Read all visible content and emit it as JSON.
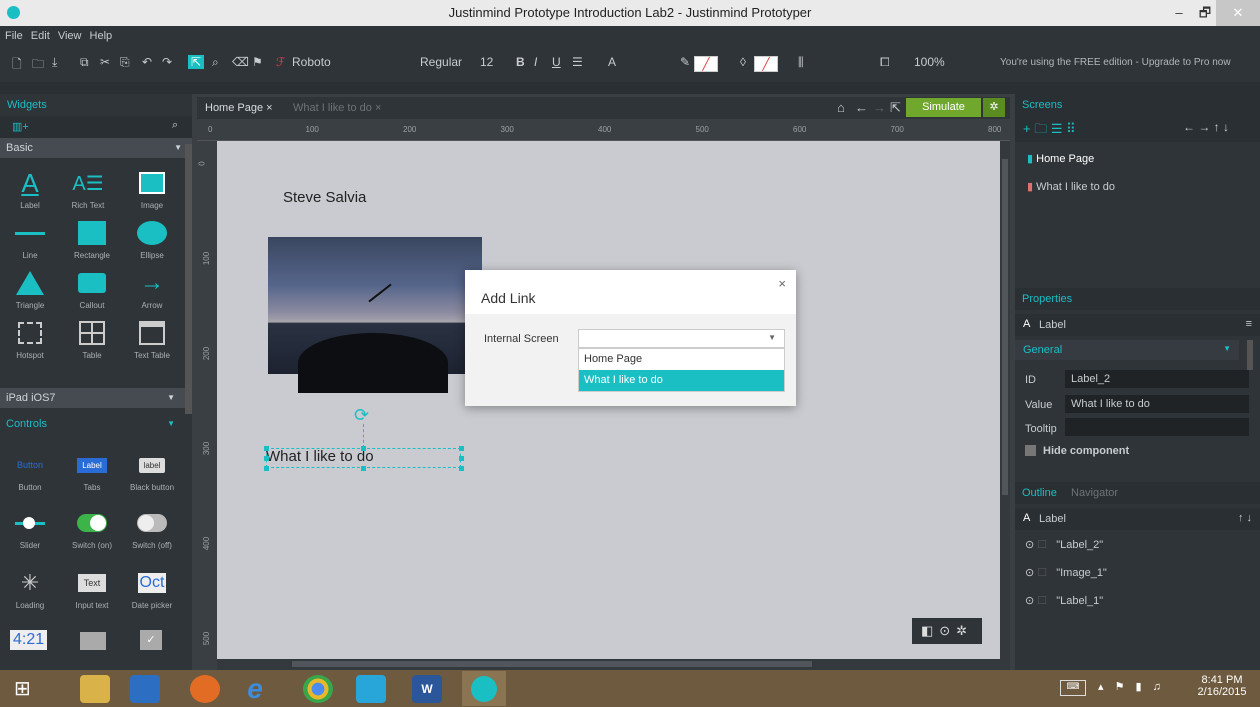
{
  "window": {
    "title": "Justinmind Prototype Introduction Lab2 - Justinmind Prototyper",
    "minimize": "–",
    "maximize": "🗗",
    "close": "✕"
  },
  "menu": [
    "File",
    "Edit",
    "View",
    "Help"
  ],
  "toolbar": {
    "font": "Roboto",
    "weight": "Regular",
    "size": "12",
    "bold": "B",
    "italic": "I",
    "underline": "U",
    "text_color": "A",
    "zoom": "100%",
    "notice": "You're using the FREE edition - Upgrade to Pro now"
  },
  "left_panel": {
    "title": "Widgets",
    "group_basic": "Basic",
    "group_ipad": "iPad iOS7",
    "group_controls": "Controls",
    "basic": [
      {
        "label": "Label",
        "icon": "label-icon"
      },
      {
        "label": "Rich Text",
        "icon": "rich-text-icon"
      },
      {
        "label": "Image",
        "icon": "image-icon"
      },
      {
        "label": "Line",
        "icon": "line-icon"
      },
      {
        "label": "Rectangle",
        "icon": "rectangle-icon"
      },
      {
        "label": "Ellipse",
        "icon": "ellipse-icon"
      },
      {
        "label": "Triangle",
        "icon": "triangle-icon"
      },
      {
        "label": "Callout",
        "icon": "callout-icon"
      },
      {
        "label": "Arrow",
        "icon": "arrow-icon"
      },
      {
        "label": "Hotspot",
        "icon": "hotspot-icon"
      },
      {
        "label": "Table",
        "icon": "table-icon"
      },
      {
        "label": "Text Table",
        "icon": "text-table-icon"
      }
    ],
    "controls": [
      {
        "label": "Button",
        "preview": "Button"
      },
      {
        "label": "Tabs",
        "preview": "Label"
      },
      {
        "label": "Black button",
        "preview": "label"
      },
      {
        "label": "Slider",
        "preview": ""
      },
      {
        "label": "Switch (on)",
        "preview": ""
      },
      {
        "label": "Switch (off)",
        "preview": ""
      },
      {
        "label": "Loading",
        "preview": ""
      },
      {
        "label": "Input text",
        "preview": "Text"
      },
      {
        "label": "Date picker",
        "preview": "Oct"
      }
    ],
    "bottom_preview": "4:21"
  },
  "tabs": [
    {
      "label": "Home Page",
      "close": "×"
    },
    {
      "label": "What I like to do",
      "close": "×"
    }
  ],
  "simulate": "Simulate",
  "ruler": [
    "0",
    "100",
    "200",
    "300",
    "400",
    "500",
    "600",
    "700",
    "800"
  ],
  "vruler": [
    "0",
    "100",
    "200",
    "300",
    "400",
    "500"
  ],
  "canvas": {
    "name_label": "Steve Salvia",
    "selected_label": "What I like to do"
  },
  "dialog": {
    "title": "Add Link",
    "close": "×",
    "field_label": "Internal Screen",
    "options": [
      "Home Page",
      "What I like to do"
    ],
    "selected_option": "What I like to do"
  },
  "screens": {
    "title": "Screens",
    "items": [
      "Home Page",
      "What I like to do"
    ]
  },
  "properties": {
    "title": "Properties",
    "component": "Label",
    "section": "General",
    "id_label": "ID",
    "id_value": "Label_2",
    "value_label": "Value",
    "value": "What I like to do",
    "tooltip_label": "Tooltip",
    "hide_label": "Hide component"
  },
  "outline": {
    "tab_outline": "Outline",
    "tab_navigator": "Navigator",
    "component": "Label",
    "items": [
      "\"Label_2\"",
      "\"Image_1\"",
      "\"Label_1\""
    ]
  },
  "taskbar": {
    "time": "8:41 PM",
    "date": "2/16/2015"
  },
  "colors": {
    "accent": "#1abfc4",
    "panel": "#2f3438",
    "canvas": "#c9cbd0",
    "selection": "#1abfc4",
    "taskbar": "#6e5a3f"
  }
}
